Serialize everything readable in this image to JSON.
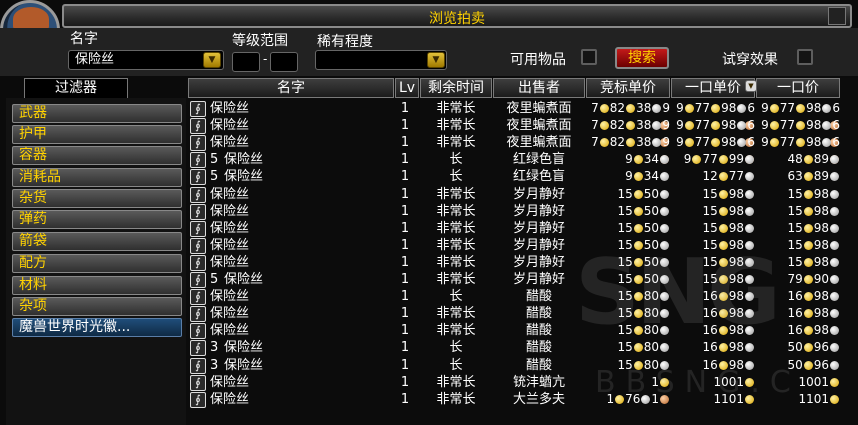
{
  "title": "浏览拍卖",
  "filters": {
    "name_label": "名字",
    "name_value": "保险丝",
    "level_label": "等级范围",
    "level_min": "",
    "level_max": "",
    "level_dash": "-",
    "rarity_label": "稀有程度",
    "rarity_value": "",
    "usable_label": "可用物品",
    "search_button": "搜索",
    "tryon_label": "试穿效果"
  },
  "sidebar": {
    "header": "过滤器",
    "categories": [
      "武器",
      "护甲",
      "容器",
      "消耗品",
      "杂货",
      "弹药",
      "箭袋",
      "配方",
      "材料",
      "杂项",
      "魔兽世界时光徽..."
    ]
  },
  "columns": [
    "名字",
    "Lv",
    "剩余时间",
    "出售者",
    "竞标单价",
    "一口单价",
    "一口价"
  ],
  "rows": [
    {
      "qty": "",
      "name": "保险丝",
      "lv": "1",
      "time": "非常长",
      "seller": "夜里蝙煮面",
      "bid": [
        "7",
        "82",
        "38",
        "9"
      ],
      "buyu": [
        "9",
        "77",
        "98",
        "6"
      ],
      "buy": [
        "9",
        "77",
        "98",
        "6"
      ]
    },
    {
      "qty": "",
      "name": "保险丝",
      "lv": "1",
      "time": "非常长",
      "seller": "夜里蝙煮面",
      "bid": [
        "7",
        "82",
        "38",
        "9"
      ],
      "buyu": [
        "9",
        "77",
        "98",
        "6"
      ],
      "buy": [
        "9",
        "77",
        "98",
        "6"
      ]
    },
    {
      "qty": "",
      "name": "保险丝",
      "lv": "1",
      "time": "非常长",
      "seller": "夜里蝙煮面",
      "bid": [
        "7",
        "82",
        "38",
        "9"
      ],
      "buyu": [
        "9",
        "77",
        "98",
        "6"
      ],
      "buy": [
        "9",
        "77",
        "98",
        "6"
      ]
    },
    {
      "qty": "5",
      "name": "保险丝",
      "lv": "1",
      "time": "长",
      "seller": "红绿色盲",
      "bid": [
        "",
        "9",
        "34",
        ""
      ],
      "buyu": [
        "9",
        "77",
        "99",
        ""
      ],
      "buy": [
        "",
        "48",
        "89",
        ""
      ]
    },
    {
      "qty": "5",
      "name": "保险丝",
      "lv": "1",
      "time": "长",
      "seller": "红绿色盲",
      "bid": [
        "",
        "9",
        "34",
        ""
      ],
      "buyu": [
        "",
        "12",
        "77",
        ""
      ],
      "buy": [
        "",
        "63",
        "89",
        ""
      ]
    },
    {
      "qty": "",
      "name": "保险丝",
      "lv": "1",
      "time": "非常长",
      "seller": "岁月静好",
      "bid": [
        "",
        "15",
        "50",
        ""
      ],
      "buyu": [
        "",
        "15",
        "98",
        ""
      ],
      "buy": [
        "",
        "15",
        "98",
        ""
      ]
    },
    {
      "qty": "",
      "name": "保险丝",
      "lv": "1",
      "time": "非常长",
      "seller": "岁月静好",
      "bid": [
        "",
        "15",
        "50",
        ""
      ],
      "buyu": [
        "",
        "15",
        "98",
        ""
      ],
      "buy": [
        "",
        "15",
        "98",
        ""
      ]
    },
    {
      "qty": "",
      "name": "保险丝",
      "lv": "1",
      "time": "非常长",
      "seller": "岁月静好",
      "bid": [
        "",
        "15",
        "50",
        ""
      ],
      "buyu": [
        "",
        "15",
        "98",
        ""
      ],
      "buy": [
        "",
        "15",
        "98",
        ""
      ]
    },
    {
      "qty": "",
      "name": "保险丝",
      "lv": "1",
      "time": "非常长",
      "seller": "岁月静好",
      "bid": [
        "",
        "15",
        "50",
        ""
      ],
      "buyu": [
        "",
        "15",
        "98",
        ""
      ],
      "buy": [
        "",
        "15",
        "98",
        ""
      ]
    },
    {
      "qty": "",
      "name": "保险丝",
      "lv": "1",
      "time": "非常长",
      "seller": "岁月静好",
      "bid": [
        "",
        "15",
        "50",
        ""
      ],
      "buyu": [
        "",
        "15",
        "98",
        ""
      ],
      "buy": [
        "",
        "15",
        "98",
        ""
      ]
    },
    {
      "qty": "5",
      "name": "保险丝",
      "lv": "1",
      "time": "非常长",
      "seller": "岁月静好",
      "bid": [
        "",
        "15",
        "50",
        ""
      ],
      "buyu": [
        "",
        "15",
        "98",
        ""
      ],
      "buy": [
        "",
        "79",
        "90",
        ""
      ]
    },
    {
      "qty": "",
      "name": "保险丝",
      "lv": "1",
      "time": "长",
      "seller": "醋酸",
      "bid": [
        "",
        "15",
        "80",
        ""
      ],
      "buyu": [
        "",
        "16",
        "98",
        ""
      ],
      "buy": [
        "",
        "16",
        "98",
        ""
      ]
    },
    {
      "qty": "",
      "name": "保险丝",
      "lv": "1",
      "time": "非常长",
      "seller": "醋酸",
      "bid": [
        "",
        "15",
        "80",
        ""
      ],
      "buyu": [
        "",
        "16",
        "98",
        ""
      ],
      "buy": [
        "",
        "16",
        "98",
        ""
      ]
    },
    {
      "qty": "",
      "name": "保险丝",
      "lv": "1",
      "time": "非常长",
      "seller": "醋酸",
      "bid": [
        "",
        "15",
        "80",
        ""
      ],
      "buyu": [
        "",
        "16",
        "98",
        ""
      ],
      "buy": [
        "",
        "16",
        "98",
        ""
      ]
    },
    {
      "qty": "3",
      "name": "保险丝",
      "lv": "1",
      "time": "长",
      "seller": "醋酸",
      "bid": [
        "",
        "15",
        "80",
        ""
      ],
      "buyu": [
        "",
        "16",
        "98",
        ""
      ],
      "buy": [
        "",
        "50",
        "96",
        ""
      ]
    },
    {
      "qty": "3",
      "name": "保险丝",
      "lv": "1",
      "time": "长",
      "seller": "醋酸",
      "bid": [
        "",
        "15",
        "80",
        ""
      ],
      "buyu": [
        "",
        "16",
        "98",
        ""
      ],
      "buy": [
        "",
        "50",
        "96",
        ""
      ]
    },
    {
      "qty": "",
      "name": "保险丝",
      "lv": "1",
      "time": "非常长",
      "seller": "铳沣蝤亢",
      "bid": [
        "",
        "",
        "1",
        ""
      ],
      "buyu": [
        "",
        "",
        "1001",
        ""
      ],
      "buy": [
        "",
        "",
        "1001",
        ""
      ]
    },
    {
      "qty": "",
      "name": "保险丝",
      "lv": "1",
      "time": "非常长",
      "seller": "大兰多夫",
      "bid": [
        "",
        "1",
        "76",
        "1"
      ],
      "buyu": [
        "",
        "",
        "1101",
        ""
      ],
      "buy": [
        "",
        "",
        "1101",
        ""
      ]
    }
  ],
  "watermark": {
    "main": "SNG",
    "sub": "BBSNG.C"
  }
}
